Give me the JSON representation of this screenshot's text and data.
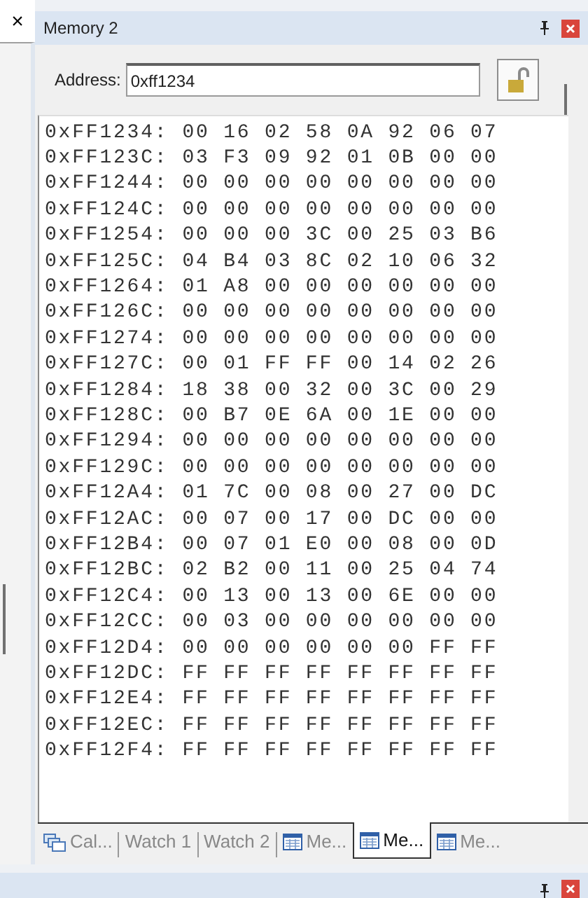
{
  "left_panel": {
    "close": "×"
  },
  "window": {
    "title": "Memory 2"
  },
  "address": {
    "label": "Address:",
    "value": "0xff1234",
    "locked": false
  },
  "rows": [
    {
      "address": "0xFF1234:",
      "bytes": "00 16 02 58 0A 92 06 07"
    },
    {
      "address": "0xFF123C:",
      "bytes": "03 F3 09 92 01 0B 00 00"
    },
    {
      "address": "0xFF1244:",
      "bytes": "00 00 00 00 00 00 00 00"
    },
    {
      "address": "0xFF124C:",
      "bytes": "00 00 00 00 00 00 00 00"
    },
    {
      "address": "0xFF1254:",
      "bytes": "00 00 00 3C 00 25 03 B6"
    },
    {
      "address": "0xFF125C:",
      "bytes": "04 B4 03 8C 02 10 06 32"
    },
    {
      "address": "0xFF1264:",
      "bytes": "01 A8 00 00 00 00 00 00"
    },
    {
      "address": "0xFF126C:",
      "bytes": "00 00 00 00 00 00 00 00"
    },
    {
      "address": "0xFF1274:",
      "bytes": "00 00 00 00 00 00 00 00"
    },
    {
      "address": "0xFF127C:",
      "bytes": "00 01 FF FF 00 14 02 26"
    },
    {
      "address": "0xFF1284:",
      "bytes": "18 38 00 32 00 3C 00 29"
    },
    {
      "address": "0xFF128C:",
      "bytes": "00 B7 0E 6A 00 1E 00 00"
    },
    {
      "address": "0xFF1294:",
      "bytes": "00 00 00 00 00 00 00 00"
    },
    {
      "address": "0xFF129C:",
      "bytes": "00 00 00 00 00 00 00 00"
    },
    {
      "address": "0xFF12A4:",
      "bytes": "01 7C 00 08 00 27 00 DC"
    },
    {
      "address": "0xFF12AC:",
      "bytes": "00 07 00 17 00 DC 00 00"
    },
    {
      "address": "0xFF12B4:",
      "bytes": "00 07 01 E0 00 08 00 0D"
    },
    {
      "address": "0xFF12BC:",
      "bytes": "02 B2 00 11 00 25 04 74"
    },
    {
      "address": "0xFF12C4:",
      "bytes": "00 13 00 13 00 6E 00 00"
    },
    {
      "address": "0xFF12CC:",
      "bytes": "00 03 00 00 00 00 00 00"
    },
    {
      "address": "0xFF12D4:",
      "bytes": "00 00 00 00 00 00 FF FF"
    },
    {
      "address": "0xFF12DC:",
      "bytes": "FF FF FF FF FF FF FF FF"
    },
    {
      "address": "0xFF12E4:",
      "bytes": "FF FF FF FF FF FF FF FF"
    },
    {
      "address": "0xFF12EC:",
      "bytes": "FF FF FF FF FF FF FF FF"
    },
    {
      "address": "0xFF12F4:",
      "bytes": "FF FF FF FF FF FF FF FF"
    }
  ],
  "tabs": [
    {
      "label": "Cal...",
      "kind": "callstack",
      "selected": false
    },
    {
      "label": "Watch 1",
      "kind": "plain",
      "selected": false
    },
    {
      "label": "Watch 2",
      "kind": "plain",
      "selected": false
    },
    {
      "label": "Me...",
      "kind": "memory",
      "selected": false
    },
    {
      "label": "Me...",
      "kind": "memory",
      "selected": true
    },
    {
      "label": "Me...",
      "kind": "memory",
      "selected": false
    }
  ]
}
